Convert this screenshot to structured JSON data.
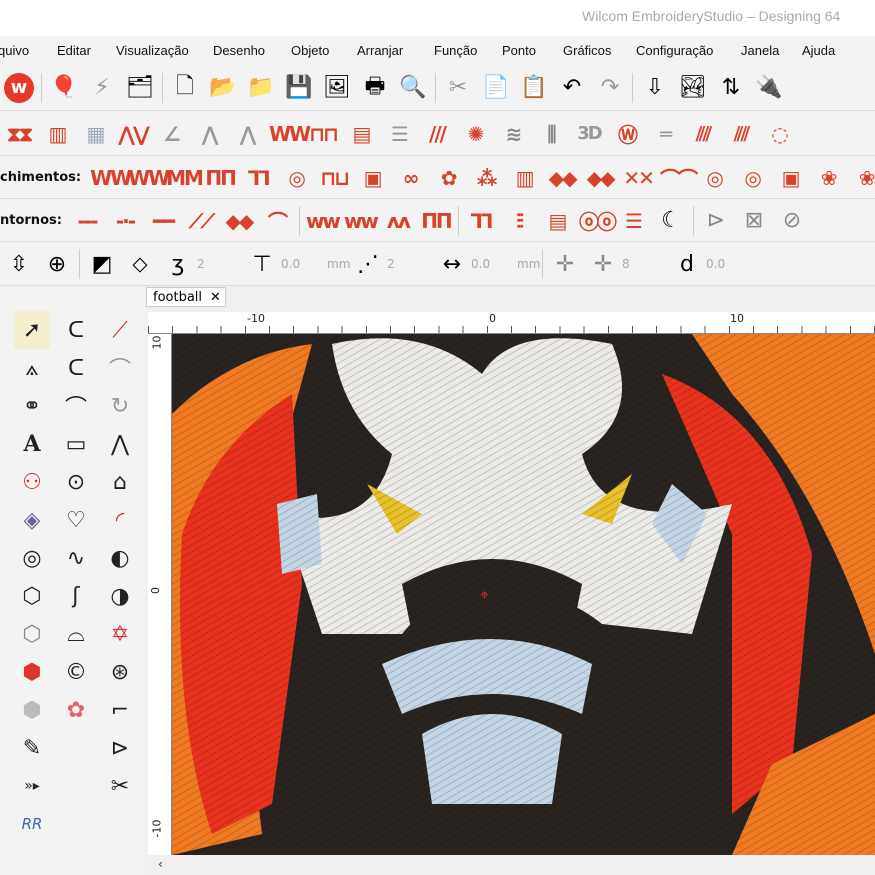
{
  "window": {
    "title": "Wilcom EmbroideryStudio – Designing 64"
  },
  "menu": [
    "quivo",
    "Editar",
    "Visualização",
    "Desenho",
    "Objeto",
    "Arranjar",
    "Função",
    "Ponto",
    "Gráficos",
    "Configuração",
    "Janela",
    "Ajuda"
  ],
  "toolbar_fill": {
    "label": "chimentos:"
  },
  "toolbar_outline": {
    "label": "ntornos:"
  },
  "toolbar_params": {
    "field1": "2",
    "field2": "0.0",
    "unit1": "mm",
    "field3": "2",
    "field4": "0.0",
    "unit2": "mm",
    "field5": "8",
    "field6": "0.0"
  },
  "document_tab": {
    "label": "football",
    "close": "✕"
  },
  "rulers": {
    "top": [
      "-10",
      "0",
      "10"
    ],
    "left": [
      "10",
      "0",
      "-10"
    ]
  },
  "colors": {
    "accent": "#d8412a",
    "thread_red": "#e8321e",
    "thread_orange": "#f07a22",
    "thread_black": "#2a2420",
    "thread_white": "#ecebe8",
    "thread_yellow": "#e6c12a",
    "thread_lightblue": "#c4d6e6"
  }
}
